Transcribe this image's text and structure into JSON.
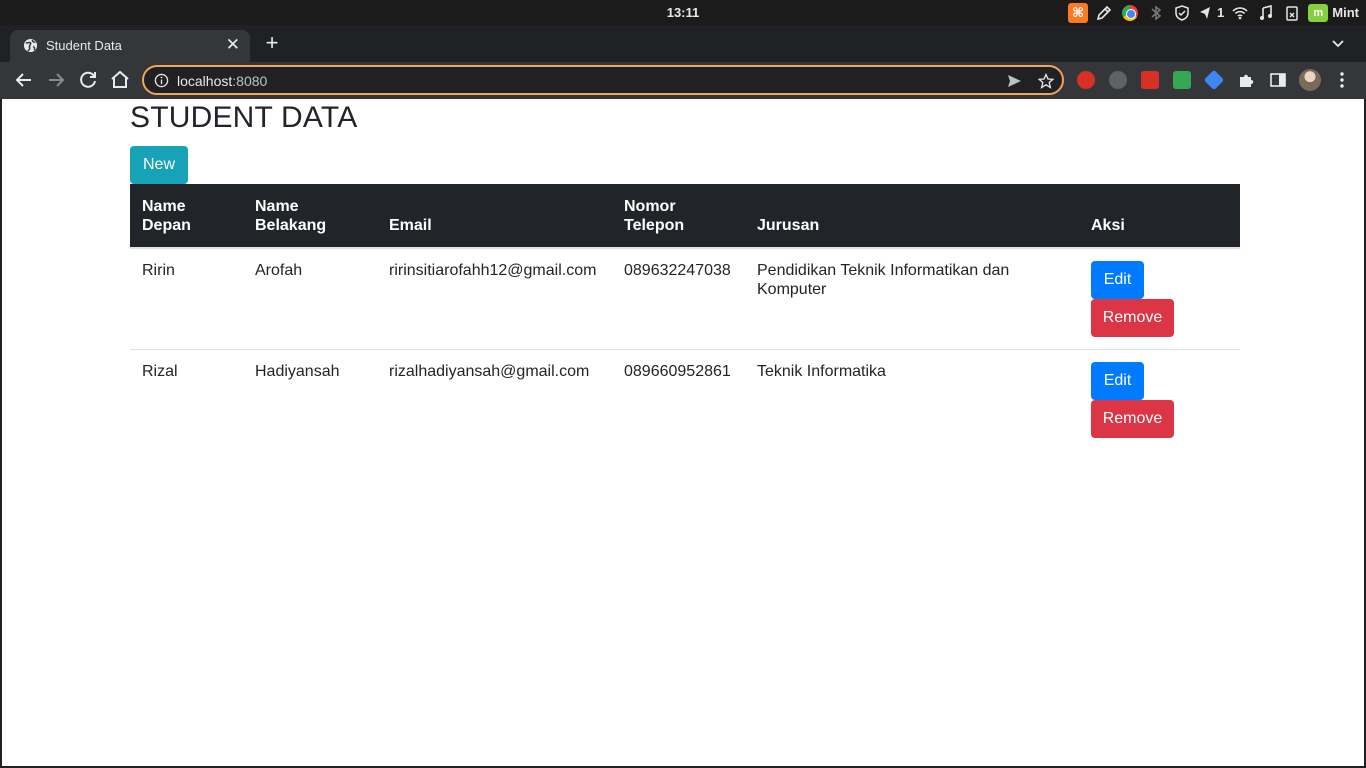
{
  "os": {
    "clock": "13:11",
    "badge_count": "1",
    "mint_label": "Mint"
  },
  "browser": {
    "tab_title": "Student Data",
    "url_host": "localhost",
    "url_port": ":8080"
  },
  "page": {
    "title": "STUDENT DATA",
    "new_button": "New",
    "headers": {
      "first_name_line1": "Name",
      "first_name_line2": "Depan",
      "last_name_line1": "Name",
      "last_name_line2": "Belakang",
      "email": "Email",
      "phone_line1": "Nomor",
      "phone_line2": "Telepon",
      "major": "Jurusan",
      "action": "Aksi"
    },
    "rows": [
      {
        "first_name": "Ririn",
        "last_name": "Arofah",
        "email": "ririnsitiarofahh12@gmail.com",
        "phone": "089632247038",
        "major": "Pendidikan Teknik Informatikan dan Komputer",
        "edit_label": "Edit",
        "remove_label": "Remove"
      },
      {
        "first_name": "Rizal",
        "last_name": "Hadiyansah",
        "email": "rizalhadiyansah@gmail.com",
        "phone": "089660952861",
        "major": "Teknik Informatika",
        "edit_label": "Edit",
        "remove_label": "Remove"
      }
    ]
  },
  "colors": {
    "header_bg": "#212529",
    "new_button": "#17a2b8",
    "edit_button": "#007bff",
    "remove_button": "#dc3545",
    "omnibox_focus": "#f0a35a"
  }
}
